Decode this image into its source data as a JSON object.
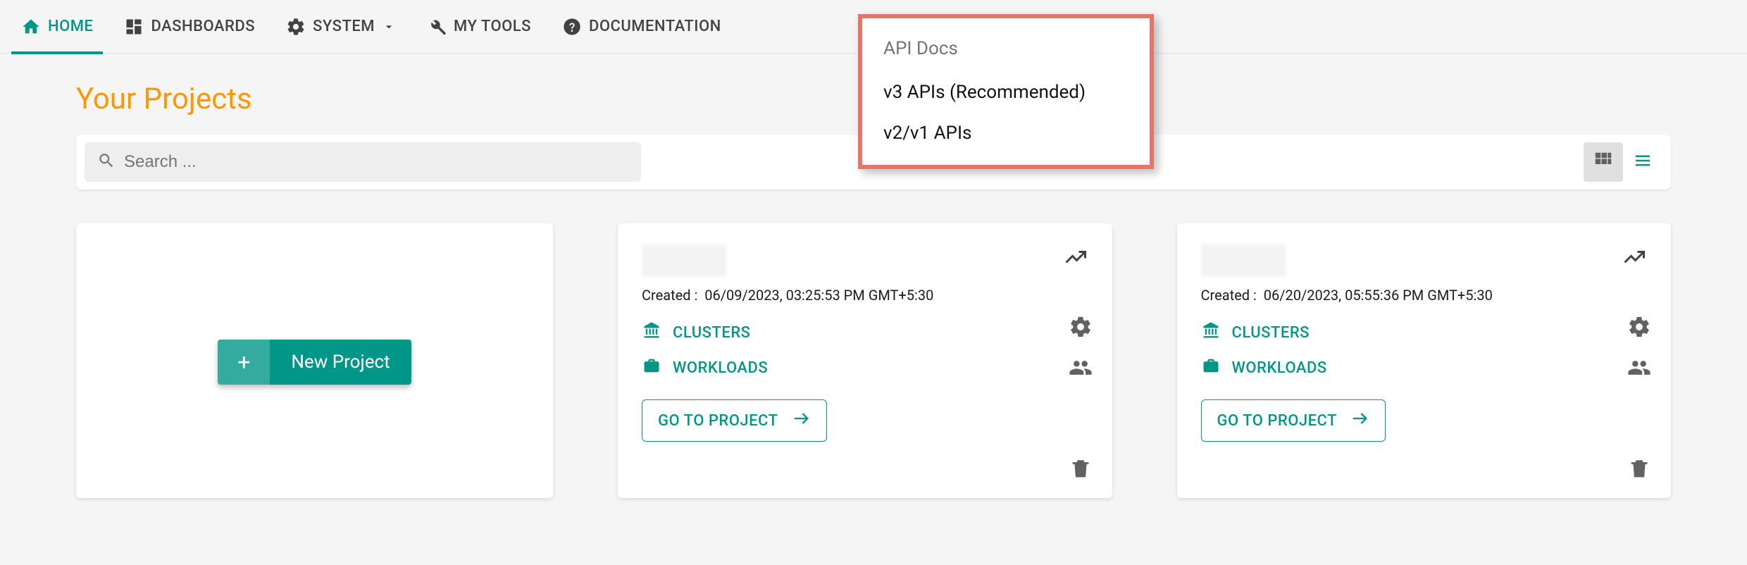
{
  "nav": {
    "home": "HOME",
    "dashboards": "DASHBOARDS",
    "system": "SYSTEM",
    "mytools": "MY TOOLS",
    "documentation": "DOCUMENTATION"
  },
  "dropdown": {
    "header": "API Docs",
    "items": [
      "v3 APIs (Recommended)",
      "v2/v1 APIs"
    ]
  },
  "page_title": "Your Projects",
  "search": {
    "placeholder": "Search ..."
  },
  "new_project_label": "New Project",
  "projects": [
    {
      "created_prefix": "Created :",
      "created_value": "06/09/2023, 03:25:53 PM GMT+5:30",
      "clusters_label": "CLUSTERS",
      "workloads_label": "WORKLOADS",
      "goto_label": "GO TO PROJECT"
    },
    {
      "created_prefix": "Created :",
      "created_value": "06/20/2023, 05:55:36 PM GMT+5:30",
      "clusters_label": "CLUSTERS",
      "workloads_label": "WORKLOADS",
      "goto_label": "GO TO PROJECT"
    }
  ]
}
